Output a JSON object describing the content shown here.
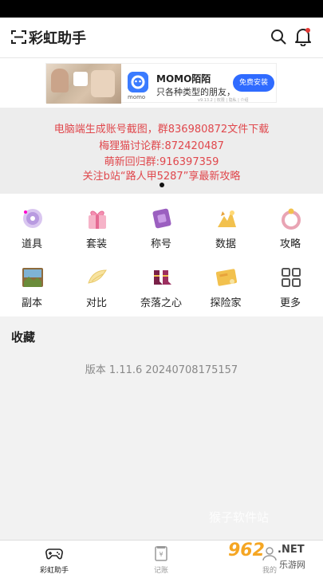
{
  "header": {
    "title": "彩虹助手",
    "scan_icon": "scan-icon",
    "search_icon": "search-icon",
    "bell_icon": "bell-icon"
  },
  "ad": {
    "app_name": "MOMO陌陌",
    "description": "只各种类型的朋友，",
    "logo_label": "momo",
    "meta": "v9.13.2 | 权限 | 隐私 | 介绍",
    "install_label": "免费安装"
  },
  "notice": {
    "lines": [
      "电脑端生成账号截图，群836980872文件下载",
      "梅狸猫讨论群:872420487",
      "萌新回归群:916397359",
      "关注b站“路人甲5287”享最新攻略"
    ]
  },
  "grid": {
    "items": [
      {
        "label": "道具",
        "icon": "prop-icon"
      },
      {
        "label": "套装",
        "icon": "gift-box-icon"
      },
      {
        "label": "称号",
        "icon": "title-badge-icon"
      },
      {
        "label": "数据",
        "icon": "data-icon"
      },
      {
        "label": "攻略",
        "icon": "ring-icon"
      },
      {
        "label": "副本",
        "icon": "dungeon-icon"
      },
      {
        "label": "对比",
        "icon": "wing-icon"
      },
      {
        "label": "奈落之心",
        "icon": "shoes-icon"
      },
      {
        "label": "探险家",
        "icon": "explorer-card-icon"
      },
      {
        "label": "更多",
        "icon": "grid-more-icon"
      }
    ]
  },
  "favorites": {
    "title": "收藏",
    "version": "版本 1.11.6 20240708175157"
  },
  "watermark": {
    "site": "猴子软件站",
    "brand_num": "962",
    "brand_net": ".NET",
    "brand_sub": "乐游网"
  },
  "bottom_nav": {
    "items": [
      {
        "label": "彩虹助手",
        "icon": "gamepad-icon",
        "active": true
      },
      {
        "label": "记账",
        "icon": "ledger-icon",
        "active": false
      },
      {
        "label": "我的",
        "icon": "profile-icon",
        "active": false
      }
    ]
  },
  "colors": {
    "notice_text": "#e0474c",
    "install_button": "#2f6bff",
    "watermark_orange": "#f5a623"
  }
}
